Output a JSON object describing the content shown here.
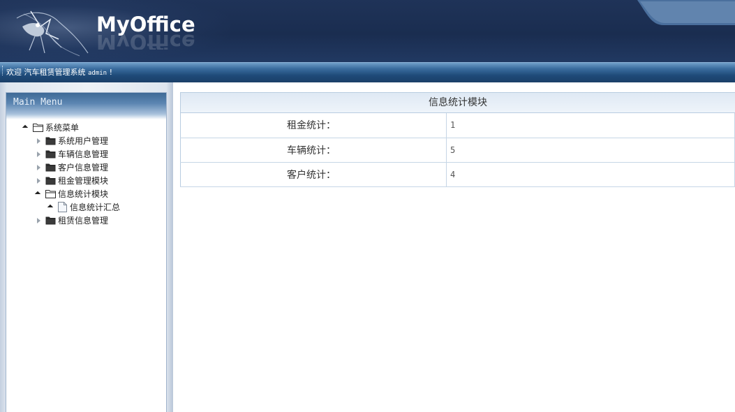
{
  "header": {
    "logo_text": "MyOffice"
  },
  "welcome_bar": {
    "prefix": "欢迎 汽车租赁管理系统 ",
    "user": "admin",
    "suffix": " !"
  },
  "sidebar": {
    "title": "Main Menu",
    "tree": [
      {
        "label": "系统菜单",
        "state": "expanded",
        "type": "folder",
        "level": 0
      },
      {
        "label": "系统用户管理",
        "state": "collapsed",
        "type": "folder",
        "level": 1
      },
      {
        "label": "车辆信息管理",
        "state": "collapsed",
        "type": "folder",
        "level": 1
      },
      {
        "label": "客户信息管理",
        "state": "collapsed",
        "type": "folder",
        "level": 1
      },
      {
        "label": "租金管理模块",
        "state": "collapsed",
        "type": "folder",
        "level": 1
      },
      {
        "label": "信息统计模块",
        "state": "expanded",
        "type": "folder",
        "level": 1
      },
      {
        "label": "信息统计汇总",
        "state": "expanded",
        "type": "file",
        "level": 2
      },
      {
        "label": "租赁信息管理",
        "state": "collapsed",
        "type": "folder",
        "level": 1
      }
    ]
  },
  "main": {
    "module_title": "信息统计模块",
    "stats": [
      {
        "label": "租金统计：",
        "value": "1"
      },
      {
        "label": "车辆统计：",
        "value": "5"
      },
      {
        "label": "客户统计：",
        "value": "4"
      }
    ]
  },
  "colors": {
    "header_bg": "#1f3358",
    "welcome_bar": "#2a5a8a",
    "table_border": "#c6d6e6",
    "module_header_bg": "#e6eef7"
  }
}
